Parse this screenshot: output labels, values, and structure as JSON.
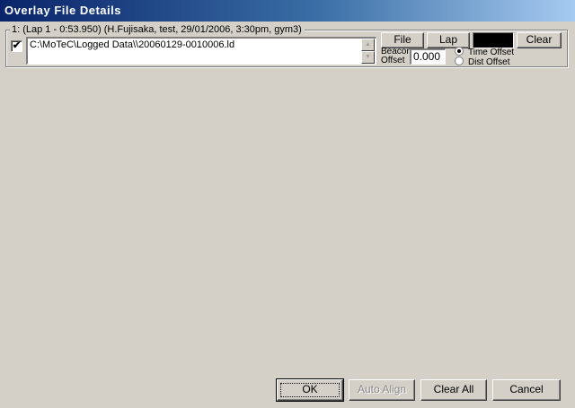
{
  "window": {
    "title": "Overlay File Details"
  },
  "overlay": {
    "group_label": "1: (Lap 1 - 0:53.950) (H.Fujisaka, test, 29/01/2006,  3:30pm, gym3)",
    "enabled": true,
    "checkmark": "✔",
    "file_path": "C:\\MoTeC\\Logged Data\\\\20060129-0010006.ld",
    "scroll_up": "▲",
    "scroll_down": "▼",
    "file_button": "File",
    "lap_button": "Lap",
    "color": "#000000",
    "clear_button": "Clear",
    "beacon_label": "Beacon Offset",
    "offset_value": "0.000",
    "offset_modes": [
      {
        "label": "Time Offset",
        "selected": true
      },
      {
        "label": "Dist Offset",
        "selected": false
      }
    ]
  },
  "footer": {
    "ok": "OK",
    "auto_align": "Auto Align",
    "clear_all": "Clear All",
    "cancel": "Cancel"
  }
}
